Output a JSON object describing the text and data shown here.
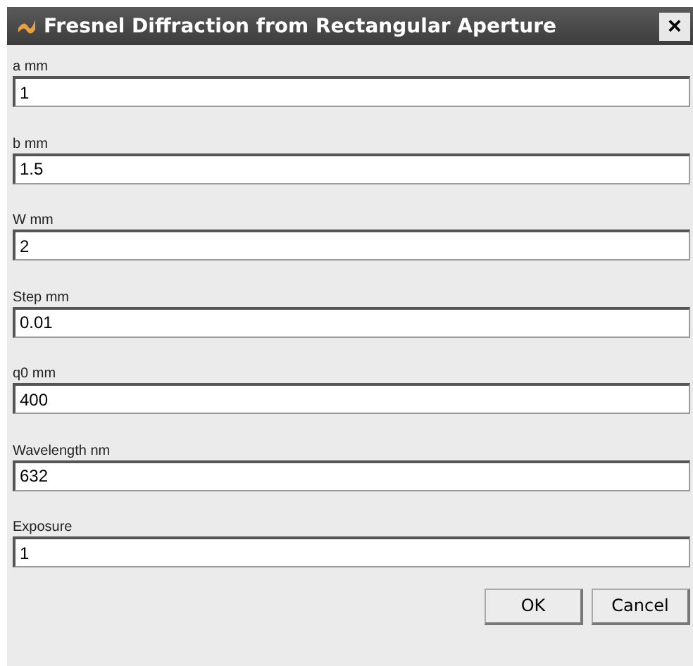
{
  "window": {
    "title": "Fresnel Diffraction from Rectangular Aperture",
    "close": "×"
  },
  "fields": [
    {
      "label": "a mm",
      "value": "1"
    },
    {
      "label": "b mm",
      "value": "1.5"
    },
    {
      "label": "W mm",
      "value": "2"
    },
    {
      "label": "Step mm",
      "value": "0.01"
    },
    {
      "label": "q0 mm",
      "value": "400"
    },
    {
      "label": "Wavelength nm",
      "value": "632"
    },
    {
      "label": "Exposure",
      "value": "1"
    }
  ],
  "buttons": [
    "OK",
    "Cancel"
  ]
}
